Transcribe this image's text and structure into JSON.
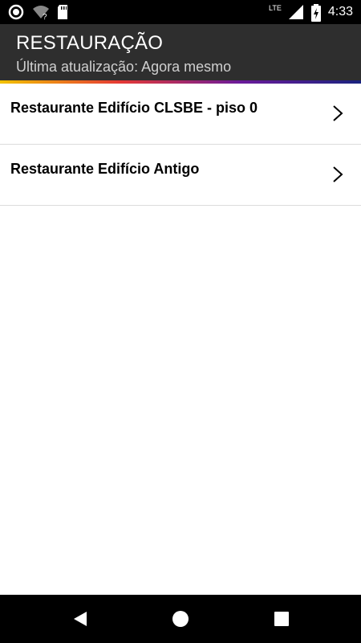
{
  "status_bar": {
    "time": "4:33",
    "network_label": "LTE",
    "icons": [
      "record-icon",
      "wifi-unknown-icon",
      "sd-card-icon",
      "cell-signal-icon",
      "battery-charging-icon"
    ]
  },
  "app_bar": {
    "title": "RESTAURAÇÃO",
    "subtitle": "Última atualização: Agora mesmo",
    "accent_gradient": [
      "#f2c200",
      "#e53935",
      "#6a1b9a",
      "#1a237e"
    ]
  },
  "list": {
    "items": [
      {
        "label": "Restaurante Edifício CLSBE - piso 0",
        "icon": "chevron-right-icon"
      },
      {
        "label": "Restaurante Edifício Antigo",
        "icon": "chevron-right-icon"
      }
    ]
  },
  "nav_bar": {
    "buttons": [
      "back-icon",
      "home-icon",
      "recents-icon"
    ]
  },
  "colors": {
    "app_bar_bg": "#2e2e2e",
    "status_bar_bg": "#000000",
    "divider": "#dcdcdc"
  }
}
